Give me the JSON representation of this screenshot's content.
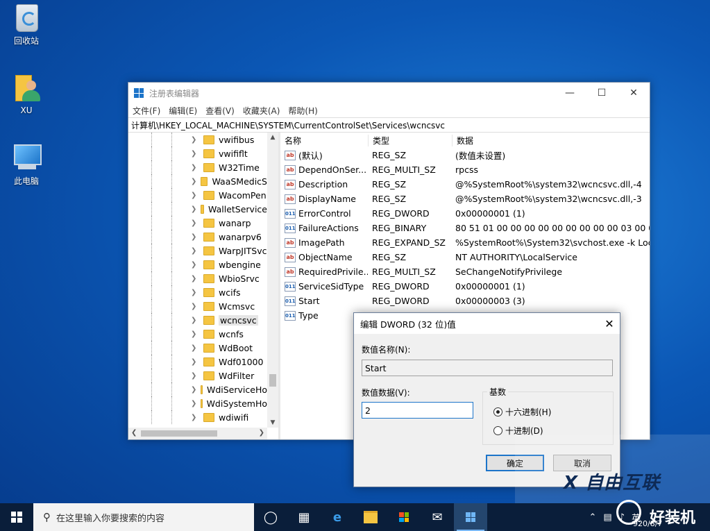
{
  "desktop": {
    "icons": [
      {
        "label": "回收站",
        "icon": "recycle-bin-icon"
      },
      {
        "label": "XU",
        "icon": "user-folder-icon"
      },
      {
        "label": "此电脑",
        "icon": "computer-icon"
      }
    ]
  },
  "regedit": {
    "title": "注册表编辑器",
    "menu": [
      "文件(F)",
      "编辑(E)",
      "查看(V)",
      "收藏夹(A)",
      "帮助(H)"
    ],
    "address": "计算机\\HKEY_LOCAL_MACHINE\\SYSTEM\\CurrentControlSet\\Services\\wcncsvc",
    "tree": [
      "vwifibus",
      "vwififlt",
      "W32Time",
      "WaaSMedicS",
      "WacomPen",
      "WalletService",
      "wanarp",
      "wanarpv6",
      "WarpJITSvc",
      "wbengine",
      "WbioSrvc",
      "wcifs",
      "Wcmsvc",
      "wcncsvc",
      "wcnfs",
      "WdBoot",
      "Wdf01000",
      "WdFilter",
      "WdiServiceHo",
      "WdiSystemHo",
      "wdiwifi"
    ],
    "selected_tree_item": "wcncsvc",
    "columns": {
      "name": "名称",
      "type": "类型",
      "data": "数据"
    },
    "rows": [
      {
        "name": "(默认)",
        "type": "REG_SZ",
        "data": "(数值未设置)",
        "icon": "string-value-icon"
      },
      {
        "name": "DependOnSer...",
        "type": "REG_MULTI_SZ",
        "data": "rpcss",
        "icon": "string-value-icon"
      },
      {
        "name": "Description",
        "type": "REG_SZ",
        "data": "@%SystemRoot%\\system32\\wcncsvc.dll,-4",
        "icon": "string-value-icon"
      },
      {
        "name": "DisplayName",
        "type": "REG_SZ",
        "data": "@%SystemRoot%\\system32\\wcncsvc.dll,-3",
        "icon": "string-value-icon"
      },
      {
        "name": "ErrorControl",
        "type": "REG_DWORD",
        "data": "0x00000001 (1)",
        "icon": "binary-value-icon"
      },
      {
        "name": "FailureActions",
        "type": "REG_BINARY",
        "data": "80 51 01 00 00 00 00 00 00 00 00 00 03 00 00...",
        "icon": "binary-value-icon"
      },
      {
        "name": "ImagePath",
        "type": "REG_EXPAND_SZ",
        "data": "%SystemRoot%\\System32\\svchost.exe -k Loc...",
        "icon": "string-value-icon"
      },
      {
        "name": "ObjectName",
        "type": "REG_SZ",
        "data": "NT AUTHORITY\\LocalService",
        "icon": "string-value-icon"
      },
      {
        "name": "RequiredPrivile...",
        "type": "REG_MULTI_SZ",
        "data": "SeChangeNotifyPrivilege",
        "icon": "string-value-icon"
      },
      {
        "name": "ServiceSidType",
        "type": "REG_DWORD",
        "data": "0x00000001 (1)",
        "icon": "binary-value-icon"
      },
      {
        "name": "Start",
        "type": "REG_DWORD",
        "data": "0x00000003 (3)",
        "icon": "binary-value-icon"
      },
      {
        "name": "Type",
        "type": "",
        "data": "",
        "icon": "binary-value-icon"
      }
    ]
  },
  "dialog": {
    "title": "编辑 DWORD (32 位)值",
    "name_label": "数值名称(N):",
    "name_value": "Start",
    "data_label": "数值数据(V):",
    "data_value": "2",
    "base_label": "基数",
    "radio_hex": "十六进制(H)",
    "radio_dec": "十进制(D)",
    "selected_base": "hex",
    "ok": "确定",
    "cancel": "取消"
  },
  "watermark": {
    "line1": "X 自由互联",
    "line2": "好装机",
    "date": "920/8/7"
  },
  "taskbar": {
    "search_placeholder": "在这里输入你要搜索的内容",
    "tray_ime": "英",
    "apps": [
      "cortana-icon",
      "task-view-icon",
      "edge-icon",
      "file-explorer-icon",
      "store-icon",
      "mail-icon",
      "regedit-icon"
    ]
  },
  "colors": {
    "accent": "#1c74c9",
    "taskbar": "#0a1e3a"
  }
}
